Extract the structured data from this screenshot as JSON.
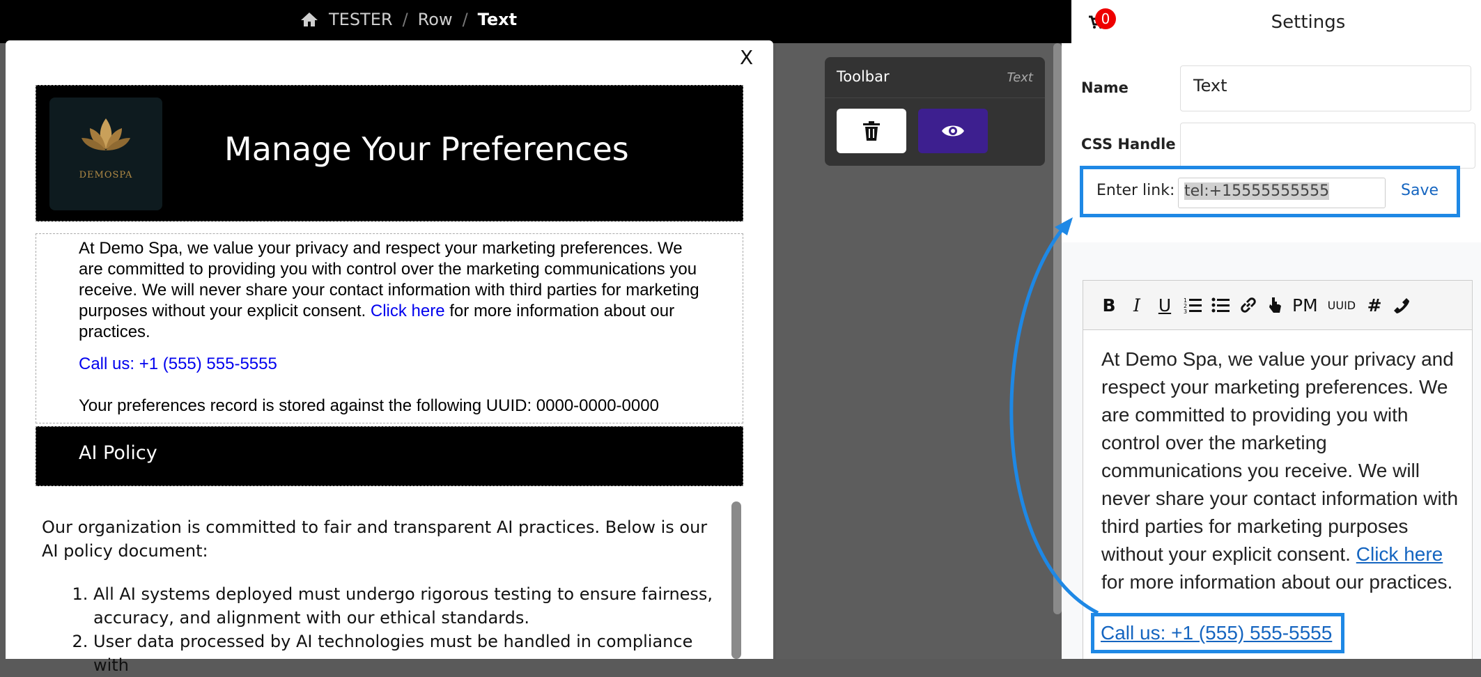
{
  "breadcrumb": {
    "items": [
      "TESTER",
      "Row",
      "Text"
    ]
  },
  "modal": {
    "close_label": "X",
    "header": {
      "logo_text": "DEMOSPA",
      "title": "Manage Your Preferences"
    },
    "body": {
      "intro": "At Demo Spa, we value your privacy and respect your marketing preferences. We are committed to providing you with control over the marketing communications you receive. We will never share your contact information with third parties for marketing purposes without your explicit consent.",
      "link_text": "Click here",
      "intro_tail": "for more information about our practices.",
      "call_text": "Call us: +1 (555) 555-5555",
      "uuid_text": "Your preferences record is stored against the following UUID: 0000-0000-0000"
    },
    "ai_policy": {
      "title": "AI Policy",
      "intro": "Our organization is committed to fair and transparent AI practices. Below is our AI policy document:",
      "items": [
        "All AI systems deployed must undergo rigorous testing to ensure fairness, accuracy, and alignment with our ethical standards.",
        "User data processed by AI technologies must be handled in compliance with"
      ]
    }
  },
  "toolbar": {
    "title": "Toolbar",
    "type_badge": "Text"
  },
  "cart": {
    "count": "0"
  },
  "settings": {
    "title": "Settings",
    "name_label": "Name",
    "name_value": "Text",
    "css_handle_label": "CSS Handle",
    "css_handle_value": "",
    "link_editor": {
      "label": "Enter link:",
      "value": "tel:+15555555555",
      "save_label": "Save"
    },
    "editor_toolbar": [
      "B",
      "I",
      "U",
      "PM",
      "UUID",
      "#"
    ],
    "editor_text": {
      "intro": "At Demo Spa, we value your privacy and respect your marketing preferences. We are committed to providing you with control over the marketing communications you receive. We will never share your contact information with third parties for marketing purposes without your explicit consent.",
      "link_text": "Click here",
      "tail": "for more information about our practices.",
      "call_text": "Call us: +1 (555) 555-5555"
    }
  },
  "colors": {
    "highlight": "#1e88e5",
    "toolbar_eye_button": "#3d1f8f",
    "link": "#0000ee",
    "badge": "#e00000"
  }
}
